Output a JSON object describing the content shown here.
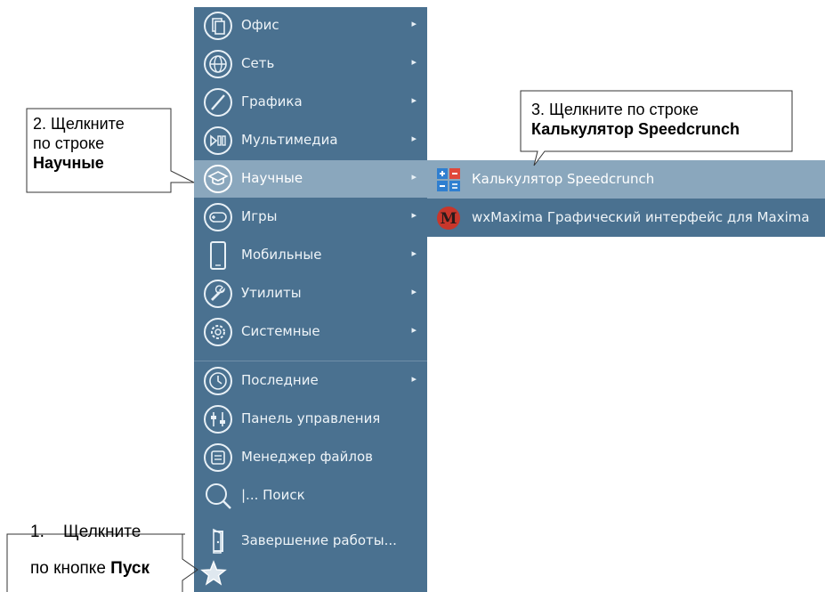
{
  "menu": {
    "items": [
      {
        "label": "Офис",
        "icon": "office-icon",
        "arrow": "▸"
      },
      {
        "label": "Сеть",
        "icon": "network-icon",
        "arrow": "▸"
      },
      {
        "label": "Графика",
        "icon": "graphics-icon",
        "arrow": "▸"
      },
      {
        "label": "Мультимедиа",
        "icon": "multimedia-icon",
        "arrow": "▸"
      },
      {
        "label": "Научные",
        "icon": "science-icon",
        "arrow": "▸"
      },
      {
        "label": "Игры",
        "icon": "games-icon",
        "arrow": "▸"
      },
      {
        "label": "Мобильные",
        "icon": "mobile-icon",
        "arrow": "▸"
      },
      {
        "label": "Утилиты",
        "icon": "utilities-icon",
        "arrow": "▸"
      },
      {
        "label": "Системные",
        "icon": "system-icon",
        "arrow": "▸"
      },
      {
        "label": "Последние",
        "icon": "recent-icon",
        "arrow": "▸"
      },
      {
        "label": "Панель управления",
        "icon": "control-panel-icon"
      },
      {
        "label": "Менеджер файлов",
        "icon": "file-manager-icon"
      },
      {
        "label": "|... Поиск",
        "icon": "search-icon"
      },
      {
        "label": "Завершение работы...",
        "icon": "shutdown-icon"
      }
    ],
    "active_index": 4
  },
  "submenu": {
    "items": [
      {
        "label": "Калькулятор Speedcrunch",
        "icon": "calculator-icon"
      },
      {
        "label": "wxMaxima Графический интерфейс для Maxima",
        "icon": "maxima-icon"
      }
    ]
  },
  "start_button": {
    "icon": "star-icon"
  },
  "callouts": {
    "step1": {
      "line1": "1.    Щелкните",
      "line2_prefix": "по кнопке ",
      "line2_bold": "Пуск"
    },
    "step2": {
      "line1": "2. Щелкните",
      "line2": "по строке",
      "line3_bold": "Научные"
    },
    "step3": {
      "line1": "3. Щелкните по строке",
      "line2_bold": "Калькулятор   Speedcrunch"
    }
  },
  "colors": {
    "menu_bg": "#4a7190",
    "active_bg": "#8aa7bd",
    "text": "#eef4f8"
  }
}
